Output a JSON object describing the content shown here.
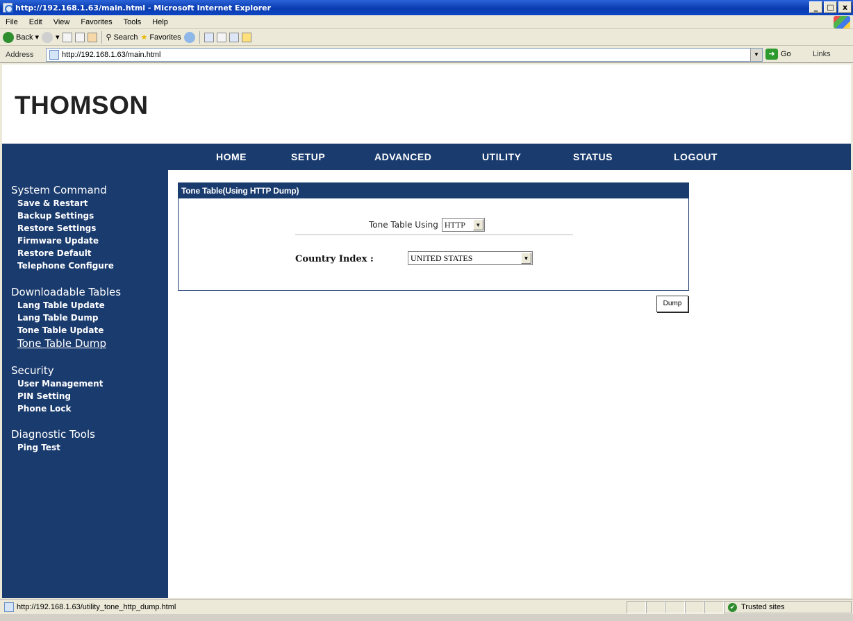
{
  "window": {
    "title": "http://192.168.1.63/main.html - Microsoft Internet Explorer",
    "controls": {
      "minimize": "_",
      "maximize": "□",
      "close": "x"
    }
  },
  "menubar": {
    "items": [
      "File",
      "Edit",
      "View",
      "Favorites",
      "Tools",
      "Help"
    ]
  },
  "toolbar": {
    "back": "Back",
    "search": "Search",
    "favorites": "Favorites"
  },
  "addressbar": {
    "label": "Address",
    "url": "http://192.168.1.63/main.html",
    "go": "Go",
    "links": "Links"
  },
  "page": {
    "logo": "THOMSON",
    "nav": [
      "HOME",
      "SETUP",
      "ADVANCED",
      "UTILITY",
      "STATUS",
      "LOGOUT"
    ],
    "sidebar": {
      "groups": [
        {
          "title": "System Command",
          "items": [
            "Save & Restart",
            "Backup Settings",
            "Restore Settings",
            "Firmware Update",
            "Restore Default",
            "Telephone Configure"
          ]
        },
        {
          "title": "Downloadable Tables",
          "items": [
            "Lang Table Update",
            "Lang Table Dump",
            "Tone Table Update",
            "Tone Table Dump"
          ],
          "active": "Tone Table Dump"
        },
        {
          "title": "Security",
          "items": [
            "User Management",
            "PIN Setting",
            "Phone Lock"
          ]
        },
        {
          "title": "Diagnostic Tools",
          "items": [
            "Ping Test"
          ]
        }
      ]
    },
    "panel": {
      "header": "Tone Table(Using HTTP Dump)",
      "tone_table_label": "Tone Table Using",
      "tone_table_value": "HTTP",
      "country_label": "Country Index :",
      "country_value": "UNITED STATES"
    },
    "dump_button": "Dump"
  },
  "statusbar": {
    "url": "http://192.168.1.63/utility_tone_http_dump.html",
    "zone": "Trusted sites"
  },
  "colors": {
    "nav_blue": "#1a3b6e",
    "title_blue": "#0a3cb0",
    "chrome": "#ece9d8"
  }
}
